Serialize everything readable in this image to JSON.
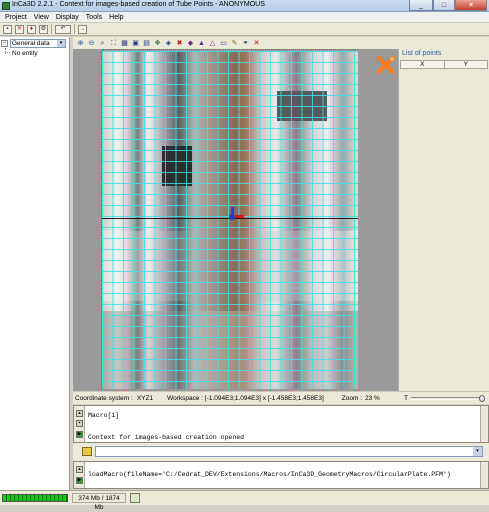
{
  "window": {
    "title": "InCa3D 2.2.1 - Context for images-based creation of Tube Points - ANONYMOUS",
    "minimize": "_",
    "maximize": "□",
    "close": "×"
  },
  "menu": [
    "Project",
    "View",
    "Display",
    "Tools",
    "Help"
  ],
  "tree": {
    "collapse": "−",
    "combo_value": "General data",
    "combo_arrow": "▾",
    "item": "No entity"
  },
  "points_panel": {
    "title": "List of points",
    "columns": [
      "X",
      "Y"
    ]
  },
  "status": {
    "coordinate_label": "Coordinate system :",
    "coordinate_value": "XYZ1",
    "workspace": "Workspace : [-1.094E3;1.094E3] x [-1.458E3;1.458E3]",
    "zoom_label": "Zoom :",
    "zoom_value": "23 %",
    "slider_label": "T"
  },
  "console": {
    "lines": [
      "Macro[1]",
      "",
      "Context for images-based creation opened"
    ]
  },
  "command": {
    "text": "loadMacro(fileName='C:/Cedrat_DEV/Extensions/Macros/InCa3D_GeometryMacros/CircularPlate.PFM')"
  },
  "memory": {
    "text": "374 Mb / 1874 Mb"
  },
  "colors": {
    "grid": "#40e0e8",
    "accent": "#2a5cae",
    "logo": "#ff7a1a"
  }
}
